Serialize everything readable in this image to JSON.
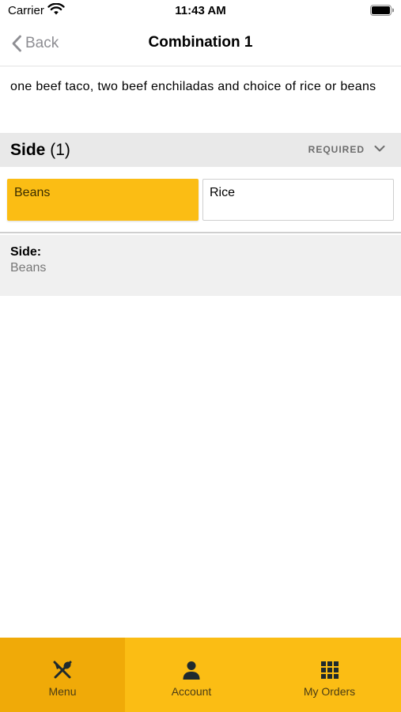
{
  "status": {
    "carrier": "Carrier",
    "time": "11:43 AM"
  },
  "nav": {
    "back_label": "Back",
    "title": "Combination 1"
  },
  "item": {
    "description": "one beef taco, two beef enchiladas and choice of rice or beans"
  },
  "section": {
    "title": "Side",
    "count": "(1)",
    "badge": "REQUIRED"
  },
  "options": [
    {
      "label": "Beans",
      "selected": true
    },
    {
      "label": "Rice",
      "selected": false
    }
  ],
  "summary": {
    "label": "Side:",
    "value": "Beans"
  },
  "tabs": [
    {
      "label": "Menu",
      "icon": "utensils-icon",
      "active": true
    },
    {
      "label": "Account",
      "icon": "person-icon",
      "active": false
    },
    {
      "label": "My Orders",
      "icon": "grid-icon",
      "active": false
    }
  ],
  "colors": {
    "accent": "#fbbd14",
    "accent_active": "#f0aa08",
    "section_bg": "#e9e9e9",
    "summary_bg": "#f0f0f0"
  }
}
